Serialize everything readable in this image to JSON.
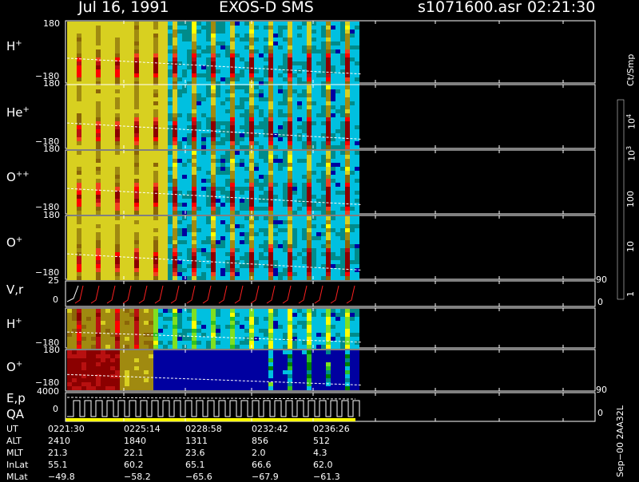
{
  "header": {
    "date": "Jul 16, 1991",
    "mission": "EXOS-D SMS",
    "file": "s1071600.asr",
    "time": "02:21:30"
  },
  "colorbar": {
    "unit": "Ct/Smp",
    "labels": [
      {
        "text": "10",
        "sup": "4",
        "value": 10000
      },
      {
        "text": "10",
        "sup": "3",
        "value": 1000
      },
      {
        "text": "100",
        "value": 100
      },
      {
        "text": "10",
        "value": 10
      },
      {
        "text": "1",
        "value": 1
      }
    ],
    "colors": [
      "#ffffff",
      "#8b0000",
      "#b81010",
      "#ff0000",
      "#f04020",
      "#8b6508",
      "#a08a10",
      "#d8d020",
      "#ffff00",
      "#80e020",
      "#30c020",
      "#008000",
      "#008b8b",
      "#00c0e0",
      "#0000a0",
      "#000080"
    ]
  },
  "panels": [
    {
      "id": "h-plus",
      "label": "H",
      "sup": "+",
      "ymax": "180",
      "ymin": "−180"
    },
    {
      "id": "he-plus",
      "label": "He",
      "sup": "+",
      "ymax": "180",
      "ymin": "−180"
    },
    {
      "id": "o-plusplus",
      "label": "O",
      "sup": "++",
      "ymax": "180",
      "ymin": "−180"
    },
    {
      "id": "o-plus",
      "label": "O",
      "sup": "+",
      "ymax": "180",
      "ymin": "−180"
    },
    {
      "id": "vr",
      "label": "V,r",
      "sup": "",
      "ymax": "25",
      "ymin": "0",
      "right_max": "90",
      "right_min": "0"
    },
    {
      "id": "h-plus-2",
      "label": "H",
      "sup": "+",
      "ymax": "180",
      "ymin": "−180"
    },
    {
      "id": "o-plus-2",
      "label": "O",
      "sup": "+",
      "ymax": "180",
      "ymin": "−180"
    },
    {
      "id": "ep-qa",
      "label": "E,p",
      "label2": "QA",
      "ymax": "4000",
      "ymin": "0",
      "right_max": "90",
      "right_min": "0"
    }
  ],
  "footer": {
    "rows": [
      {
        "name": "UT",
        "values": [
          "0221:30",
          "0225:14",
          "0228:58",
          "0232:42",
          "0236:26"
        ]
      },
      {
        "name": "ALT",
        "values": [
          "2410",
          "1840",
          "1311",
          "856",
          "512"
        ]
      },
      {
        "name": "MLT",
        "values": [
          "21.3",
          "22.1",
          "23.6",
          "2.0",
          "4.3"
        ]
      },
      {
        "name": "InLat",
        "values": [
          "55.1",
          "60.2",
          "65.1",
          "66.6",
          "62.0"
        ]
      },
      {
        "name": "MLat",
        "values": [
          "−49.8",
          "−58.2",
          "−65.6",
          "−67.9",
          "−61.3"
        ]
      }
    ],
    "side_note": "Sep−00 2AA32L"
  },
  "chart_data": {
    "type": "heatmap",
    "x": [
      "0221:30",
      "0225:14",
      "0228:58",
      "0232:42",
      "0236:26"
    ],
    "panels": [
      "H+",
      "He+",
      "O++",
      "O+",
      "V,r",
      "H+",
      "O+",
      "E,p QA"
    ],
    "ylim_angle": [
      -180,
      180
    ],
    "ylim_vr": [
      0,
      25
    ],
    "ylim_ep": [
      0,
      4000
    ],
    "colorscale": "log",
    "color_range": [
      1,
      10000
    ]
  }
}
